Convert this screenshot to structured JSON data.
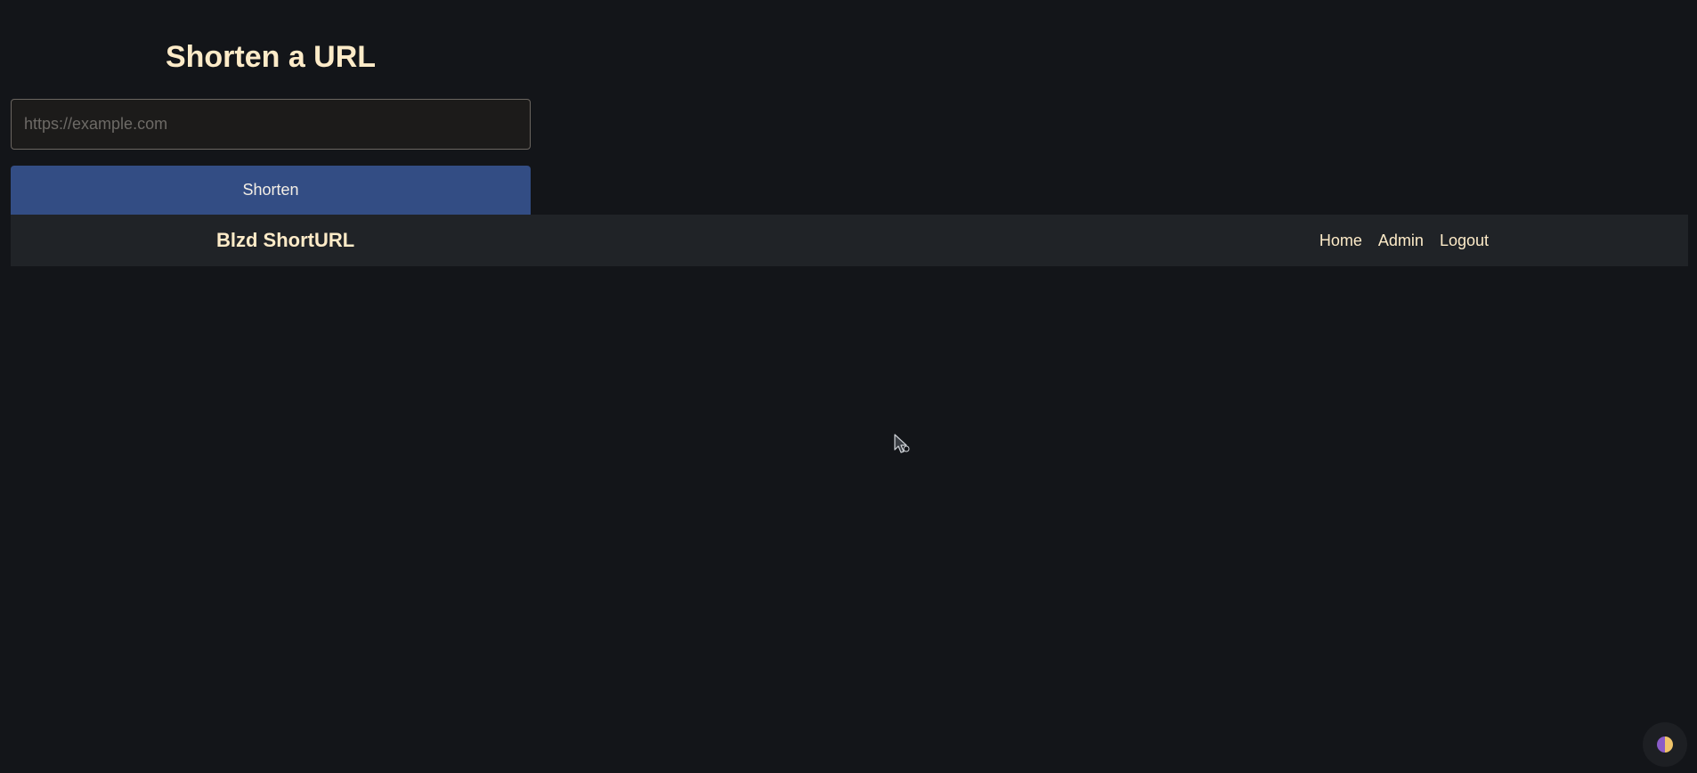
{
  "form": {
    "title": "Shorten a URL",
    "url_input": {
      "value": "",
      "placeholder": "https://example.com"
    },
    "submit_label": "Shorten"
  },
  "navbar": {
    "brand": "Blzd ShortURL",
    "links": [
      {
        "label": "Home"
      },
      {
        "label": "Admin"
      },
      {
        "label": "Logout"
      }
    ]
  },
  "theme_toggle": {
    "icon": "half-moon-icon",
    "colors": [
      "#8a5cc8",
      "#f0c46a"
    ]
  },
  "colors": {
    "background": "#131519",
    "navbar": "#202327",
    "accent_button": "#334d84",
    "text_cream": "#fdebc8"
  }
}
